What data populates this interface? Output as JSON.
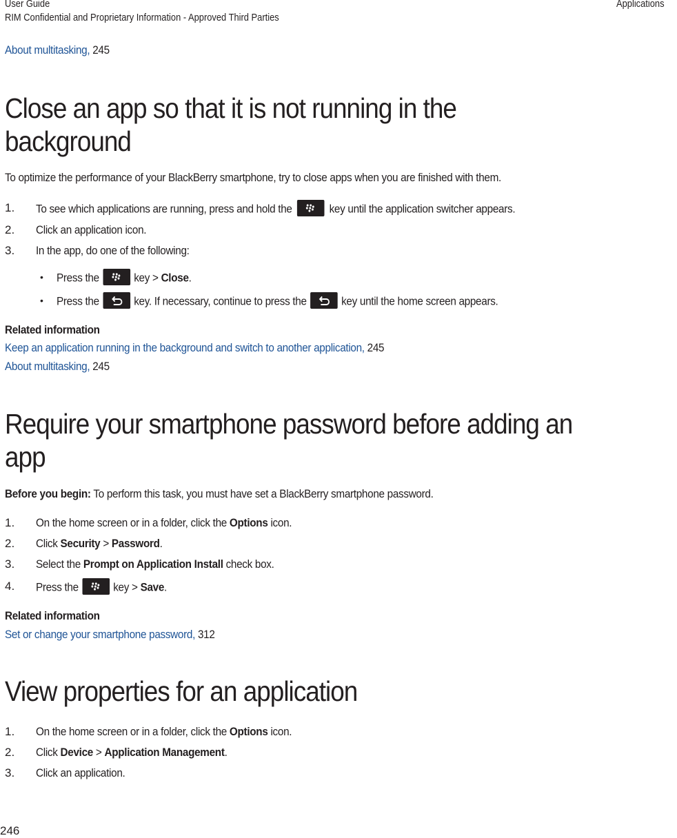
{
  "header": {
    "guide": "User Guide",
    "confidential": "RIM Confidential and Proprietary Information - Approved Third Parties",
    "section": "Applications"
  },
  "top_link": {
    "text": "About multitasking,",
    "page": " 245"
  },
  "section1": {
    "title_line1": "Close an app so that it is not running in the",
    "title_line2": "background",
    "intro": "To optimize the performance of your BlackBerry smartphone, try to close apps when you are finished with them.",
    "steps": [
      {
        "num": "1.",
        "pre": "To see which applications are running, press and hold the",
        "post": "key until the application switcher appears."
      },
      {
        "num": "2.",
        "text": "Click an application icon."
      },
      {
        "num": "3.",
        "text": "In the app, do one of the following:"
      }
    ],
    "bullets": [
      {
        "pre": "Press the",
        "mid": "key >",
        "bold": "Close",
        "end": "."
      },
      {
        "pre": "Press the",
        "mid": "key. If necessary, continue to press the",
        "post": "key until the home screen appears."
      }
    ],
    "related_heading": "Related information",
    "related": [
      {
        "text": "Keep an application running in the background and switch to another application,",
        "page": " 245"
      },
      {
        "text": "About multitasking,",
        "page": " 245"
      }
    ]
  },
  "section2": {
    "title_line1": "Require your smartphone password before adding an",
    "title_line2": "app",
    "before_label": "Before you begin:",
    "before_text": " To perform this task, you must have set a BlackBerry smartphone password.",
    "steps": [
      {
        "num": "1.",
        "pre": "On the home screen or in a folder, click the ",
        "bold": "Options",
        "post": " icon."
      },
      {
        "num": "2.",
        "pre": "Click ",
        "bold": "Security",
        "mid": " > ",
        "bold2": "Password",
        "post": "."
      },
      {
        "num": "3.",
        "pre": "Select the ",
        "bold": "Prompt on Application Install",
        "post": " check box."
      },
      {
        "num": "4.",
        "pre": "Press the",
        "mid": "key > ",
        "bold": "Save",
        "post": "."
      }
    ],
    "related_heading": "Related information",
    "related": [
      {
        "text": "Set or change your smartphone password,",
        "page": " 312"
      }
    ]
  },
  "section3": {
    "title": "View properties for an application",
    "steps": [
      {
        "num": "1.",
        "pre": "On the home screen or in a folder, click the ",
        "bold": "Options",
        "post": " icon."
      },
      {
        "num": "2.",
        "pre": "Click ",
        "bold": "Device",
        "mid": " > ",
        "bold2": "Application Management",
        "post": "."
      },
      {
        "num": "3.",
        "text": "Click an application."
      }
    ]
  },
  "footer": {
    "page_number": "246"
  },
  "icons": {
    "menu_key": "blackberry-menu-key-icon",
    "escape_key": "escape-back-key-icon"
  },
  "colors": {
    "link": "#1f5496",
    "text": "#231f20",
    "key_bg": "#231f20"
  }
}
